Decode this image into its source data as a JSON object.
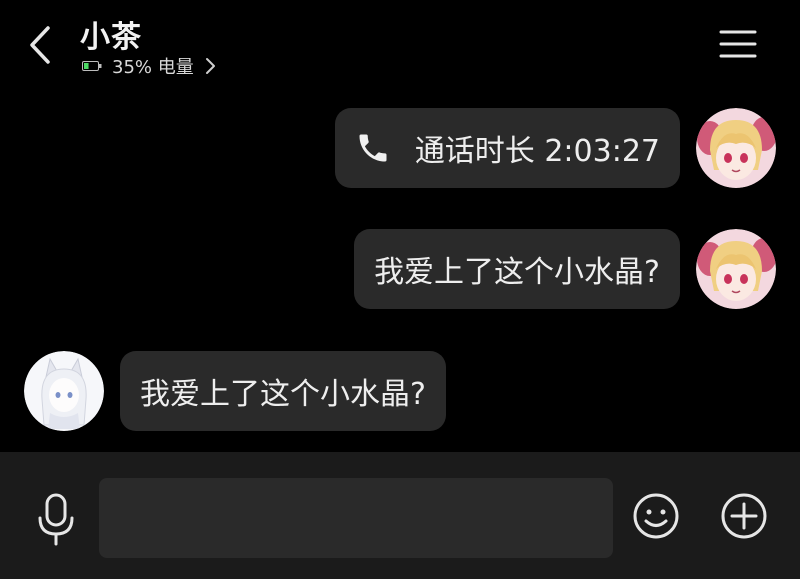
{
  "header": {
    "contact_name": "小茶",
    "battery_text": "35% 电量",
    "battery_level": 0.35,
    "back_icon": "chevron-left-icon",
    "menu_icon": "hamburger-menu-icon"
  },
  "messages": [
    {
      "side": "right",
      "type": "call",
      "icon": "phone-icon",
      "text": "通话时长 2:03:27"
    },
    {
      "side": "right",
      "type": "text",
      "text": "我爱上了这个小水晶?"
    },
    {
      "side": "left",
      "type": "text",
      "text": "我爱上了这个小水晶?"
    }
  ],
  "input_bar": {
    "mic_icon": "microphone-icon",
    "text_value": "",
    "emoji_icon": "smiley-icon",
    "plus_icon": "plus-circle-icon"
  },
  "colors": {
    "background": "#000000",
    "bubble": "#2a2a2a",
    "input_bar": "#1b1b1b",
    "battery_green": "#4cd964"
  }
}
